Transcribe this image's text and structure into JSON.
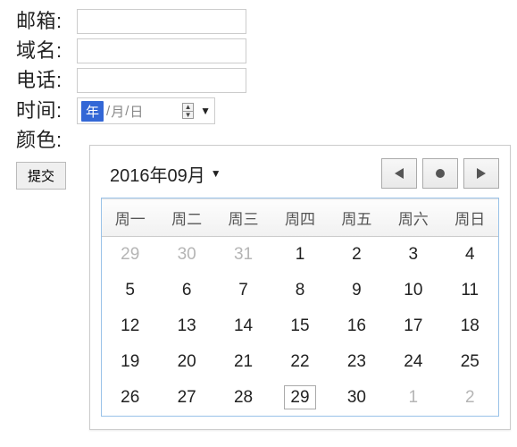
{
  "form": {
    "email": {
      "label": "邮箱:",
      "value": ""
    },
    "domain": {
      "label": "域名:",
      "value": ""
    },
    "phone": {
      "label": "电话:",
      "value": ""
    },
    "time": {
      "label": "时间:",
      "year_ph": "年",
      "month_ph": "月",
      "day_ph": "日"
    },
    "color": {
      "label": "颜色:"
    },
    "submit": "提交"
  },
  "calendar": {
    "title": "2016年09月",
    "weekdays": [
      "周一",
      "周二",
      "周三",
      "周四",
      "周五",
      "周六",
      "周日"
    ],
    "weeks": [
      [
        {
          "d": "29",
          "o": true
        },
        {
          "d": "30",
          "o": true
        },
        {
          "d": "31",
          "o": true
        },
        {
          "d": "1"
        },
        {
          "d": "2"
        },
        {
          "d": "3"
        },
        {
          "d": "4"
        }
      ],
      [
        {
          "d": "5"
        },
        {
          "d": "6"
        },
        {
          "d": "7"
        },
        {
          "d": "8"
        },
        {
          "d": "9"
        },
        {
          "d": "10"
        },
        {
          "d": "11"
        }
      ],
      [
        {
          "d": "12"
        },
        {
          "d": "13"
        },
        {
          "d": "14"
        },
        {
          "d": "15"
        },
        {
          "d": "16"
        },
        {
          "d": "17"
        },
        {
          "d": "18"
        }
      ],
      [
        {
          "d": "19"
        },
        {
          "d": "20"
        },
        {
          "d": "21"
        },
        {
          "d": "22"
        },
        {
          "d": "23"
        },
        {
          "d": "24"
        },
        {
          "d": "25"
        }
      ],
      [
        {
          "d": "26"
        },
        {
          "d": "27"
        },
        {
          "d": "28"
        },
        {
          "d": "29",
          "t": true
        },
        {
          "d": "30"
        },
        {
          "d": "1",
          "o": true
        },
        {
          "d": "2",
          "o": true
        }
      ]
    ]
  }
}
